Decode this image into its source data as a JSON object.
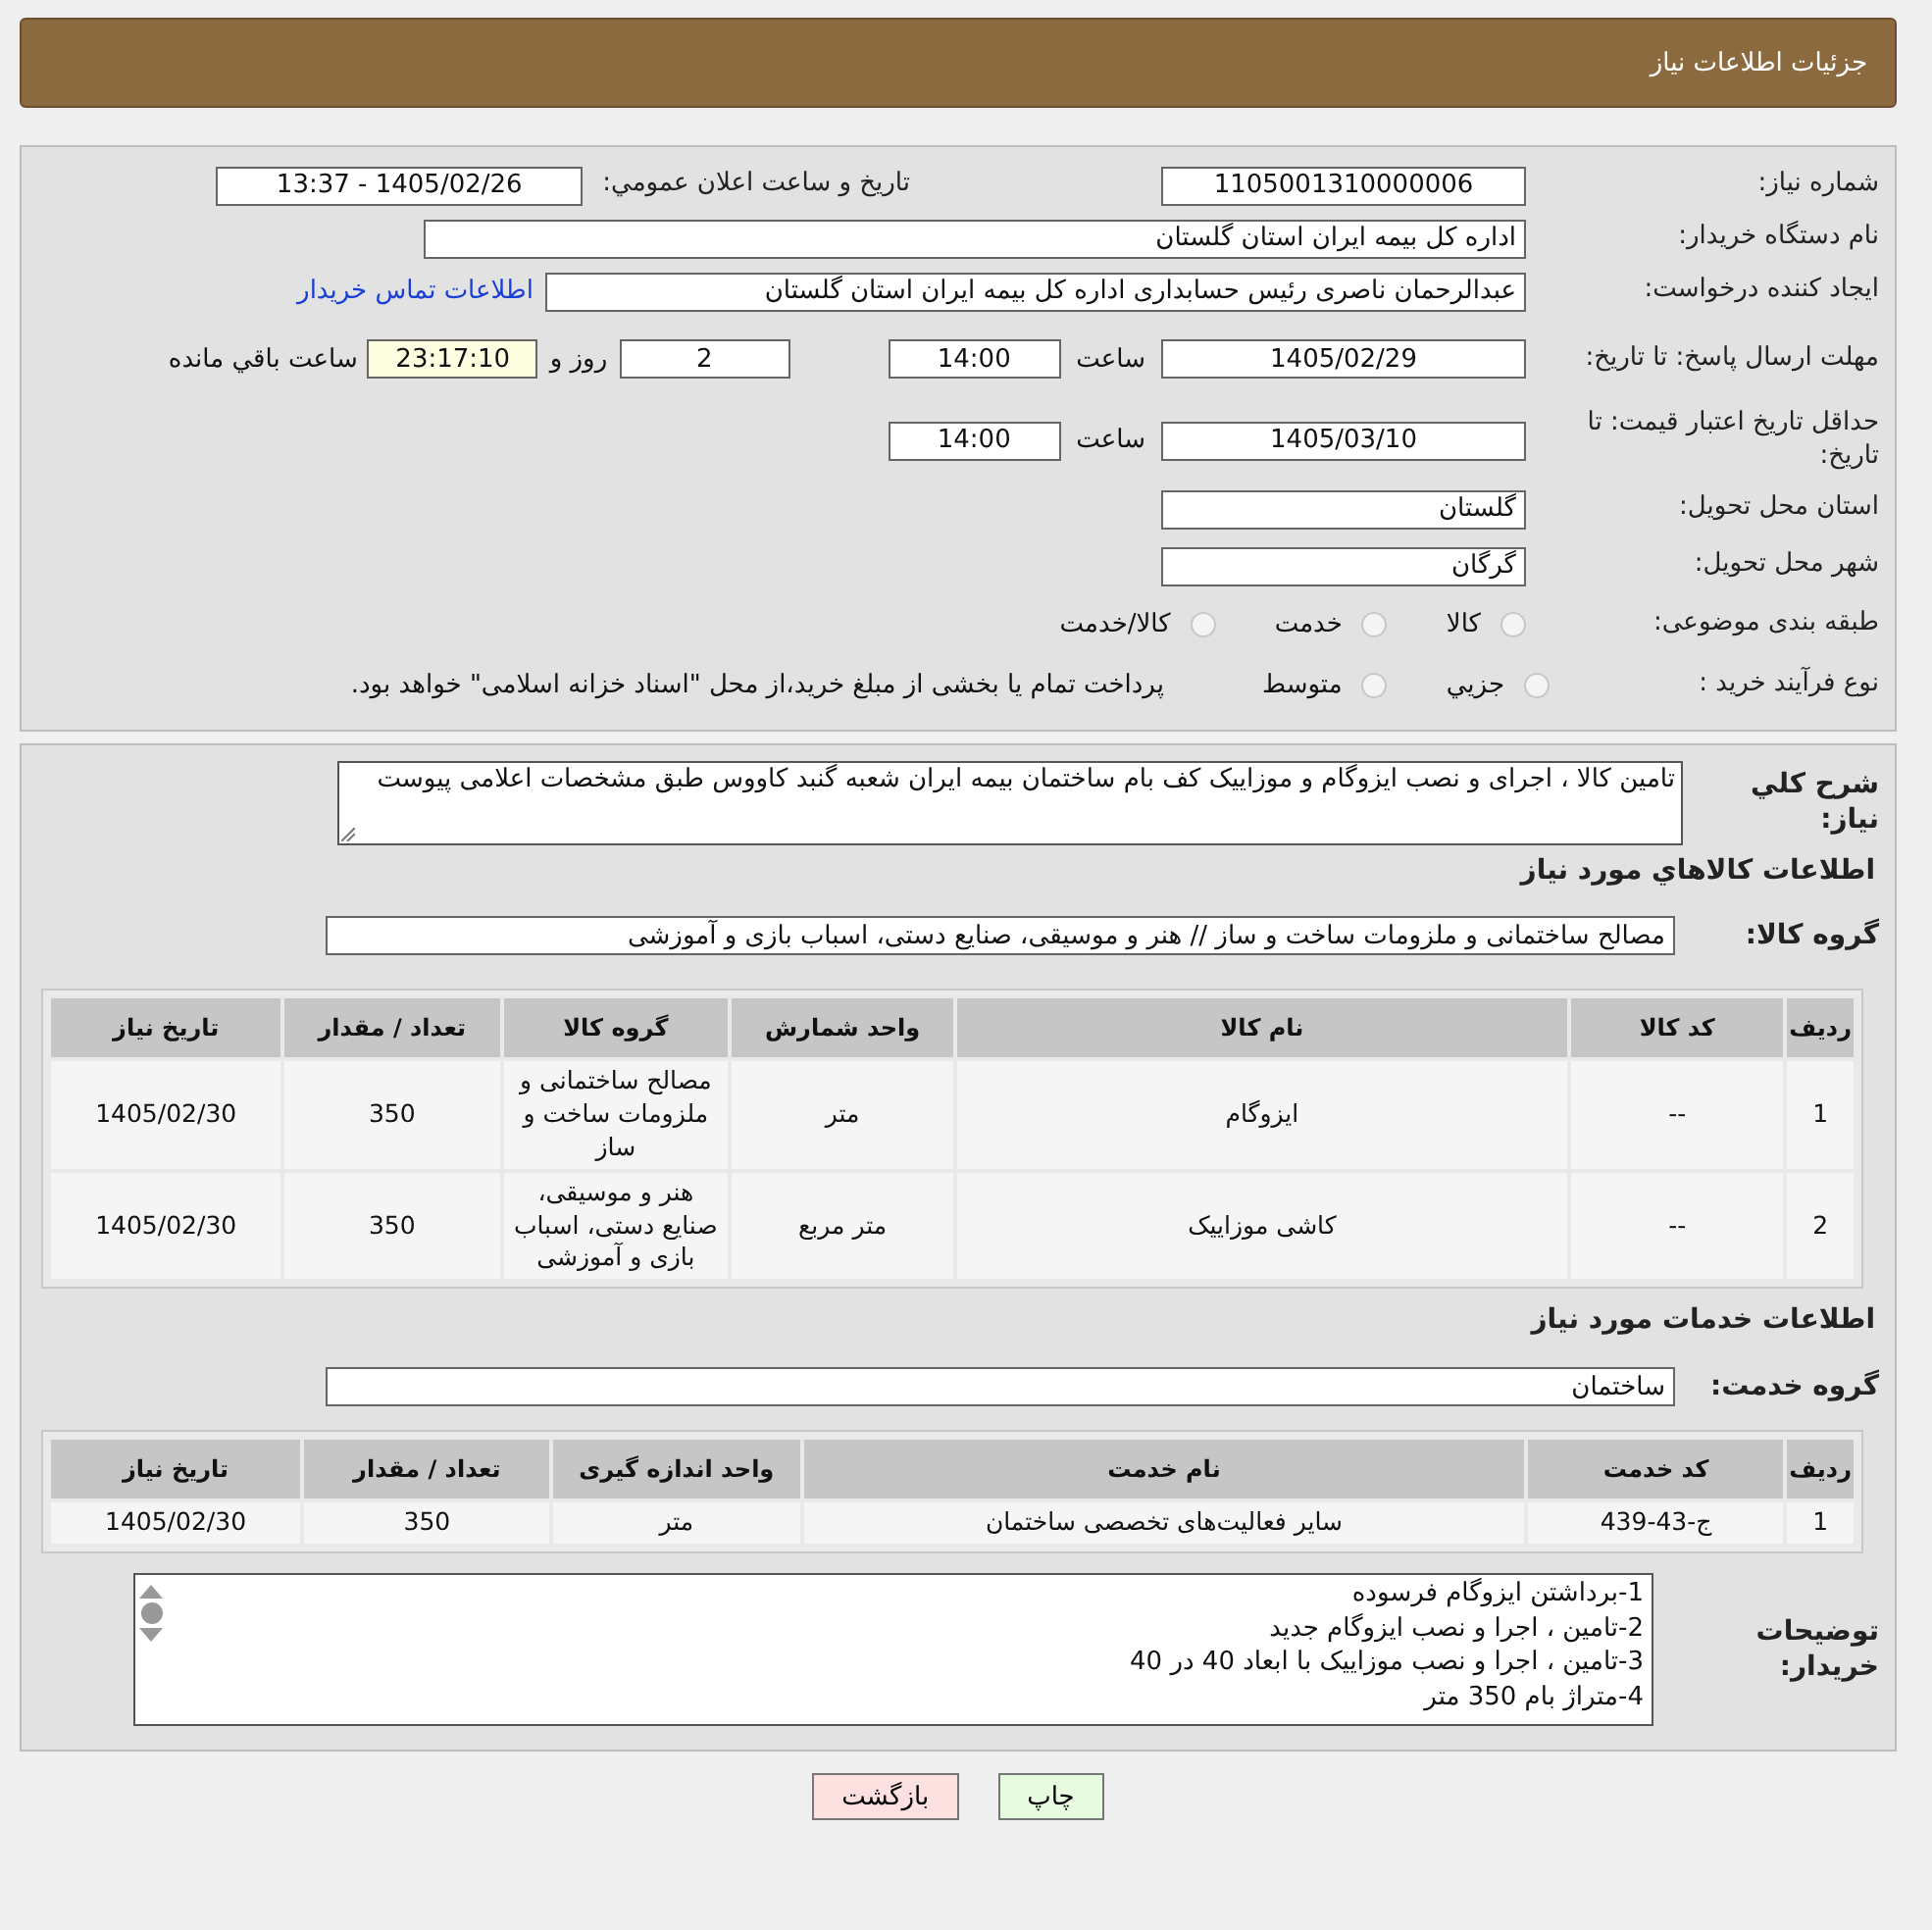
{
  "header": {
    "title": "جزئیات اطلاعات نیاز"
  },
  "details": {
    "need_number": {
      "label": "شماره نیاز:",
      "value": "1105001310000006"
    },
    "announce": {
      "label": "تاریخ و ساعت اعلان عمومي:",
      "value": "1405/02/26 - 13:37"
    },
    "buyer_org": {
      "label": "نام دستگاه خریدار:",
      "value": "اداره کل بیمه ایران استان گلستان"
    },
    "requester": {
      "label": "ایجاد کننده درخواست:",
      "value": "عبدالرحمان ناصری رئیس حسابداری اداره کل بیمه ایران استان گلستان",
      "link": "اطلاعات تماس خریدار"
    },
    "response_deadline": {
      "label": "مهلت ارسال پاسخ: تا تاریخ:",
      "date": "1405/02/29",
      "time_label": "ساعت",
      "time": "14:00",
      "days": "2",
      "days_label": "روز و",
      "remaining": "23:17:10",
      "remaining_label": "ساعت باقي مانده"
    },
    "price_validity": {
      "label": "حداقل تاریخ اعتبار قیمت: تا تاریخ:",
      "date": "1405/03/10",
      "time_label": "ساعت",
      "time": "14:00"
    },
    "province": {
      "label": "استان محل تحویل:",
      "value": "گلستان"
    },
    "city": {
      "label": "شهر محل تحویل:",
      "value": "گرگان"
    },
    "category": {
      "label": "طبقه بندی موضوعی:",
      "options": [
        {
          "label": "کالا",
          "selected": false
        },
        {
          "label": "خدمت",
          "selected": false
        },
        {
          "label": "کالا/خدمت",
          "selected": false
        }
      ]
    },
    "process": {
      "label": "نوع فرآیند خرید :",
      "options": [
        {
          "label": "جزيي",
          "selected": false
        },
        {
          "label": "متوسط",
          "selected": false
        }
      ],
      "note": "پرداخت تمام یا بخشی از مبلغ خرید،از محل \"اسناد خزانه اسلامی\" خواهد بود."
    }
  },
  "description": {
    "label": "شرح كلي نياز:",
    "value": "تامین کالا ، اجرای و نصب ایزوگام و موزاییک کف بام ساختمان بیمه ایران شعبه گنبد کاووس طبق مشخصات اعلامی پیوست"
  },
  "goods": {
    "heading": "اطلاعات كالاهاي مورد نياز",
    "group_label": "گروه کالا:",
    "group": "مصالح ساختمانی و ملزومات ساخت و ساز // هنر و موسیقی، صنایع دستی، اسباب بازی و آموزشی",
    "columns": [
      "ردیف",
      "کد کالا",
      "نام کالا",
      "واحد شمارش",
      "گروه کالا",
      "تعداد / مقدار",
      "تاریخ نیاز"
    ],
    "rows": [
      [
        "1",
        "--",
        "ایزوگام",
        "متر",
        "مصالح ساختمانی و ملزومات ساخت و ساز",
        "350",
        "1405/02/30"
      ],
      [
        "2",
        "--",
        "کاشی موزاییک",
        "متر مربع",
        "هنر و موسیقی، صنایع دستی، اسباب بازی و آموزشی",
        "350",
        "1405/02/30"
      ]
    ]
  },
  "services": {
    "heading": "اطلاعات خدمات مورد نياز",
    "group_label": "گروه خدمت:",
    "group": "ساختمان",
    "columns": [
      "ردیف",
      "کد خدمت",
      "نام خدمت",
      "واحد اندازه گیری",
      "تعداد / مقدار",
      "تاریخ نیاز"
    ],
    "rows": [
      [
        "1",
        "ج-43-439",
        "سایر فعالیت‌های تخصصی ساختمان",
        "متر",
        "350",
        "1405/02/30"
      ]
    ]
  },
  "notes": {
    "label": "توضیحات خریدار:",
    "value": "1-برداشتن ایزوگام فرسوده\n2-تامین ، اجرا و نصب ایزوگام جدید\n3-تامین ، اجرا و نصب موزاییک با ابعاد 40 در 40\n4-متراژ بام 350 متر"
  },
  "buttons": [
    {
      "kind": "print",
      "label": "چاپ"
    },
    {
      "kind": "back",
      "label": "بازگشت"
    }
  ]
}
